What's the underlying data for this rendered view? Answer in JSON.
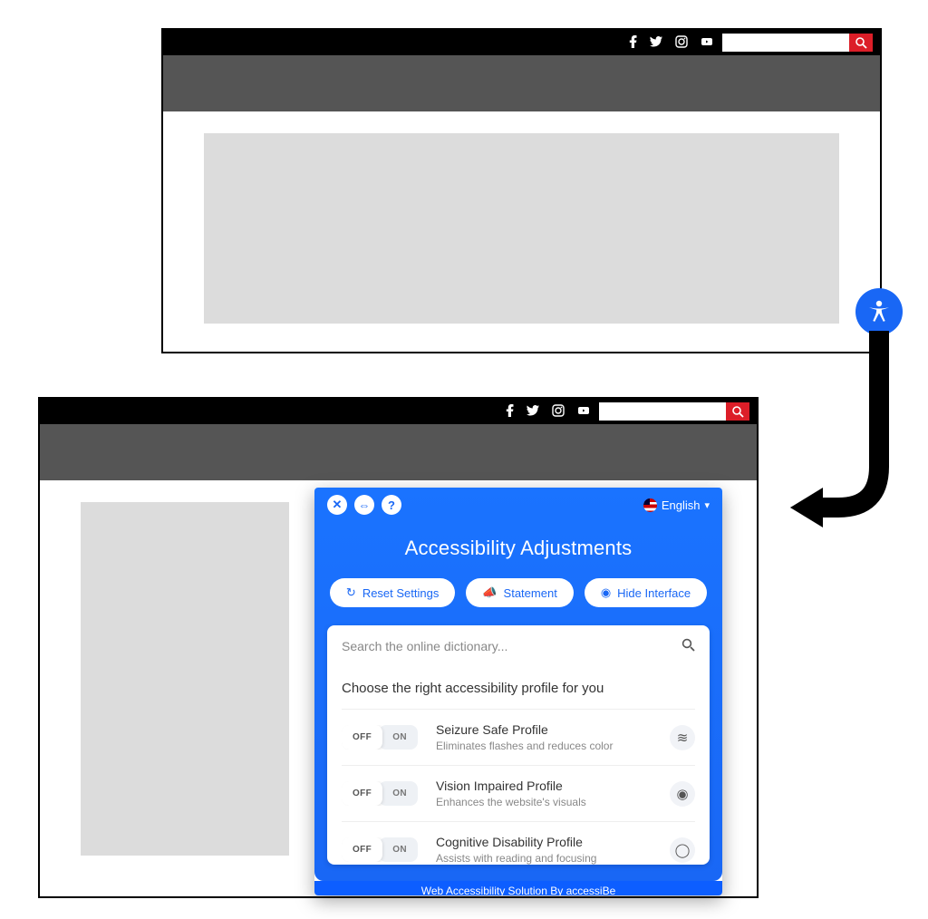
{
  "topbar": {
    "search_placeholder": "",
    "social": [
      "facebook",
      "twitter",
      "instagram",
      "youtube"
    ]
  },
  "accessibility": {
    "language_label": "English",
    "title": "Accessibility Adjustments",
    "buttons": {
      "reset": "Reset Settings",
      "statement": "Statement",
      "hide": "Hide Interface"
    },
    "search_placeholder": "Search the online dictionary...",
    "profiles_heading": "Choose the right accessibility profile for you",
    "toggle": {
      "off": "OFF",
      "on": "ON"
    },
    "profiles": [
      {
        "title": "Seizure Safe Profile",
        "desc": "Eliminates flashes and reduces color",
        "icon": "waves"
      },
      {
        "title": "Vision Impaired Profile",
        "desc": "Enhances the website's visuals",
        "icon": "eye"
      },
      {
        "title": "Cognitive Disability Profile",
        "desc": "Assists with reading and focusing",
        "icon": "chat"
      }
    ],
    "footer": "Web Accessibility Solution By accessiBe"
  }
}
